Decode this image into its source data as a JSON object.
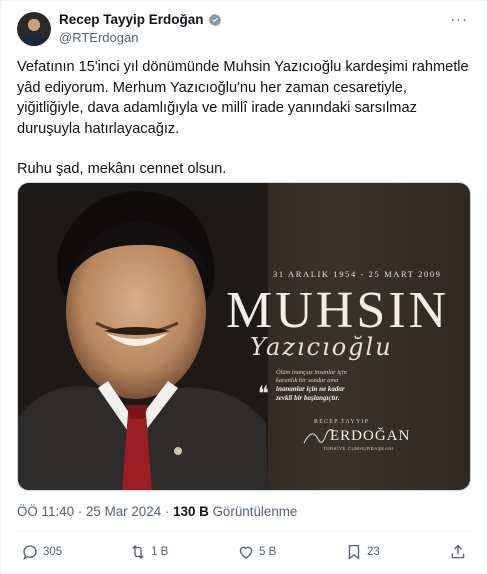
{
  "author": {
    "display_name": "Recep Tayyip Erdoğan",
    "handle": "@RTErdogan",
    "verified_icon": "verified-badge-icon",
    "more_label": "···"
  },
  "tweet_text": {
    "paragraph_1": "Vefatının 15'inci yıl dönümünde Muhsin Yazıcıoğlu kardeşimi rahmetle yâd ediyorum. Merhum Yazıcıoğlu'nu her zaman cesaretiyle, yiğitliğiyle, dava adamlığıyla ve millî irade yanındaki sarsılmaz duruşuyla hatırlayacağız.",
    "paragraph_2": "Ruhu şad, mekânı cennet olsun."
  },
  "media": {
    "dates": "31 ARALIK 1954 - 25 MART 2009",
    "name_big": "MUHSIN",
    "name_script": "Yazıcıoğlu",
    "quote_mark": "❝",
    "quote_line_1": "Ölüm inançsız insanlar için",
    "quote_line_2": "karanlık bir sondur ama",
    "quote_line_3": "inananlar için ne kadar",
    "quote_line_4": "zevkli bir başlangıçtır.",
    "signature_title": "RECEP TAYYIP",
    "signature_name": "ERDOĞAN",
    "signature_sub": "TÜRKİYE CUMHURBAŞKANI",
    "colors": {
      "background": "#2b2520",
      "text": "#f3efe6"
    }
  },
  "meta": {
    "time": "ÖÖ 11:40 · 25 Mar 2024 · ",
    "views_count": "130 B",
    "views_label": " Görüntülenme"
  },
  "actions": {
    "replies": "305",
    "reposts": "1 B",
    "likes": "5 B",
    "bookmarks": "23"
  }
}
